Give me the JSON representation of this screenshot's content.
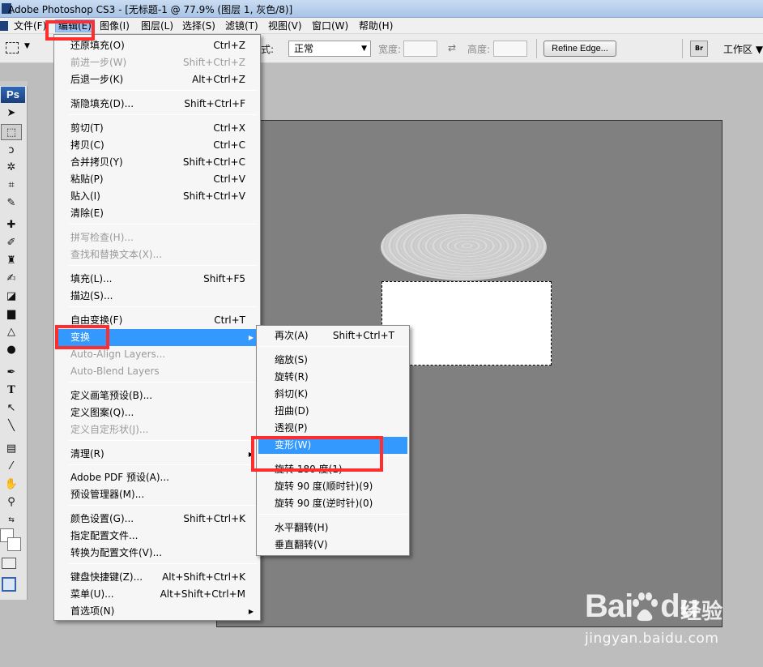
{
  "window": {
    "title": "Adobe Photoshop CS3 - [无标题-1 @ 77.9% (图层 1, 灰色/8)]"
  },
  "menubar": {
    "items": [
      "文件(F)",
      "编辑(E)",
      "图像(I)",
      "图层(L)",
      "选择(S)",
      "滤镜(T)",
      "视图(V)",
      "窗口(W)",
      "帮助(H)"
    ],
    "active": "编辑(E)"
  },
  "options_bar": {
    "style_label": "式:",
    "style_value": "正常",
    "width_label": "宽度:",
    "height_label": "高度:",
    "refine_edge_label": "Refine Edge...",
    "bridge_icon": "Br",
    "workspace_label": "工作区"
  },
  "toolbox": {
    "logo": "Ps"
  },
  "edit_menu": {
    "items": [
      {
        "label": "还原填充(O)",
        "shortcut": "Ctrl+Z",
        "disabled": false
      },
      {
        "label": "前进一步(W)",
        "shortcut": "Shift+Ctrl+Z",
        "disabled": true
      },
      {
        "label": "后退一步(K)",
        "shortcut": "Alt+Ctrl+Z",
        "disabled": false
      },
      {
        "label": "渐隐填充(D)...",
        "shortcut": "Shift+Ctrl+F",
        "disabled": false
      },
      {
        "label": "剪切(T)",
        "shortcut": "Ctrl+X",
        "disabled": false
      },
      {
        "label": "拷贝(C)",
        "shortcut": "Ctrl+C",
        "disabled": false
      },
      {
        "label": "合并拷贝(Y)",
        "shortcut": "Shift+Ctrl+C",
        "disabled": false
      },
      {
        "label": "粘贴(P)",
        "shortcut": "Ctrl+V",
        "disabled": false
      },
      {
        "label": "贴入(I)",
        "shortcut": "Shift+Ctrl+V",
        "disabled": false
      },
      {
        "label": "清除(E)",
        "shortcut": "",
        "disabled": false
      },
      {
        "label": "拼写检查(H)...",
        "shortcut": "",
        "disabled": true
      },
      {
        "label": "查找和替换文本(X)...",
        "shortcut": "",
        "disabled": true
      },
      {
        "label": "填充(L)...",
        "shortcut": "Shift+F5",
        "disabled": false
      },
      {
        "label": "描边(S)...",
        "shortcut": "",
        "disabled": false
      },
      {
        "label": "自由变换(F)",
        "shortcut": "Ctrl+T",
        "disabled": false
      },
      {
        "label": "变换",
        "shortcut": "",
        "disabled": false,
        "highlighted": true,
        "submenu": true
      },
      {
        "label": "Auto-Align Layers...",
        "shortcut": "",
        "disabled": true
      },
      {
        "label": "Auto-Blend Layers",
        "shortcut": "",
        "disabled": true
      },
      {
        "label": "定义画笔预设(B)...",
        "shortcut": "",
        "disabled": false
      },
      {
        "label": "定义图案(Q)...",
        "shortcut": "",
        "disabled": false
      },
      {
        "label": "定义自定形状(J)...",
        "shortcut": "",
        "disabled": true
      },
      {
        "label": "清理(R)",
        "shortcut": "",
        "disabled": false,
        "submenu": true
      },
      {
        "label": "Adobe PDF 预设(A)...",
        "shortcut": "",
        "disabled": false
      },
      {
        "label": "预设管理器(M)...",
        "shortcut": "",
        "disabled": false
      },
      {
        "label": "颜色设置(G)...",
        "shortcut": "Shift+Ctrl+K",
        "disabled": false
      },
      {
        "label": "指定配置文件...",
        "shortcut": "",
        "disabled": false
      },
      {
        "label": "转换为配置文件(V)...",
        "shortcut": "",
        "disabled": false
      },
      {
        "label": "键盘快捷键(Z)...",
        "shortcut": "Alt+Shift+Ctrl+K",
        "disabled": false
      },
      {
        "label": "菜单(U)...",
        "shortcut": "Alt+Shift+Ctrl+M",
        "disabled": false
      },
      {
        "label": "首选项(N)",
        "shortcut": "",
        "disabled": false,
        "submenu": true
      }
    ]
  },
  "transform_menu": {
    "items": [
      {
        "label": "再次(A)",
        "shortcut": "Shift+Ctrl+T"
      },
      {
        "label": "缩放(S)",
        "shortcut": ""
      },
      {
        "label": "旋转(R)",
        "shortcut": ""
      },
      {
        "label": "斜切(K)",
        "shortcut": ""
      },
      {
        "label": "扭曲(D)",
        "shortcut": ""
      },
      {
        "label": "透视(P)",
        "shortcut": ""
      },
      {
        "label": "变形(W)",
        "shortcut": "",
        "highlighted": true
      },
      {
        "label": "旋转 180 度(1)",
        "shortcut": ""
      },
      {
        "label": "旋转 90 度(顺时针)(9)",
        "shortcut": ""
      },
      {
        "label": "旋转 90 度(逆时针)(0)",
        "shortcut": ""
      },
      {
        "label": "水平翻转(H)",
        "shortcut": ""
      },
      {
        "label": "垂直翻转(V)",
        "shortcut": ""
      }
    ]
  },
  "watermark": {
    "brand": "Bai",
    "brand_suffix": "du",
    "product": "经验",
    "url": "jingyan.baidu.com"
  },
  "colors": {
    "menu_highlight": "#3399ff",
    "annotation_red": "#ff2d2d",
    "canvas_gray": "#808080"
  }
}
